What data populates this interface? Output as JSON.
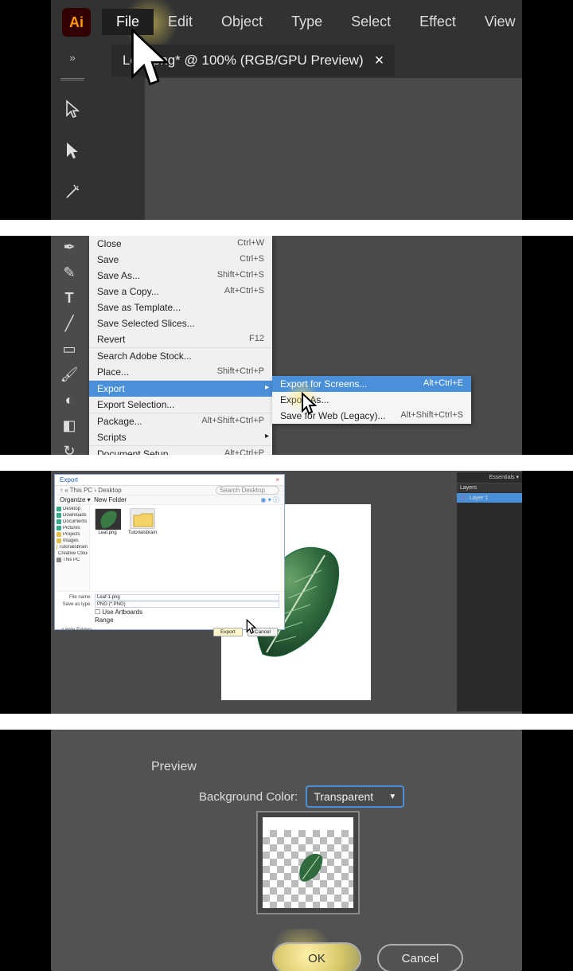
{
  "panel1": {
    "logo": "Ai",
    "menus": [
      "File",
      "Edit",
      "Object",
      "Type",
      "Select",
      "Effect",
      "View"
    ],
    "tab_title": "Leaf.png* @ 100% (RGB/GPU Preview)",
    "tab_close": "×",
    "expand_tools": "»"
  },
  "panel2": {
    "file_menu": [
      {
        "label": "Close",
        "shortcut": "Ctrl+W"
      },
      {
        "label": "Save",
        "shortcut": "Ctrl+S"
      },
      {
        "label": "Save As...",
        "shortcut": "Shift+Ctrl+S"
      },
      {
        "label": "Save a Copy...",
        "shortcut": "Alt+Ctrl+S"
      },
      {
        "label": "Save as Template...",
        "shortcut": ""
      },
      {
        "label": "Save Selected Slices...",
        "shortcut": ""
      },
      {
        "label": "Revert",
        "shortcut": "F12",
        "sep": true
      },
      {
        "label": "Search Adobe Stock...",
        "shortcut": ""
      },
      {
        "label": "Place...",
        "shortcut": "Shift+Ctrl+P",
        "sep": true
      },
      {
        "label": "Export",
        "shortcut": "",
        "hi": true,
        "sub": true
      },
      {
        "label": "Export Selection...",
        "shortcut": "",
        "sep": true
      },
      {
        "label": "Package...",
        "shortcut": "Alt+Shift+Ctrl+P"
      },
      {
        "label": "Scripts",
        "shortcut": "",
        "sub": true,
        "sep": true
      },
      {
        "label": "Document Setup...",
        "shortcut": "Alt+Ctrl+P"
      }
    ],
    "sub_menu": [
      {
        "label": "Export for Screens...",
        "shortcut": "Alt+Ctrl+E",
        "hi": true
      },
      {
        "label": "Export As...",
        "shortcut": ""
      },
      {
        "label": "Save for Web (Legacy)...",
        "shortcut": "Alt+Shift+Ctrl+S"
      }
    ]
  },
  "panel3": {
    "dialog_title": "Export",
    "breadcrumb": "↑  «  This PC  ›  Desktop",
    "search_placeholder": "Search Desktop",
    "organize": "Organize ▾",
    "newfolder": "New Folder",
    "tree": [
      "Desktop",
      "Downloads",
      "Documents",
      "Pictures",
      "Projects",
      "Images",
      "Tutorialsbrain",
      "Creative Cloud Fi",
      "This PC"
    ],
    "thumbs": [
      {
        "label": "Leaf.png"
      },
      {
        "label": "Tutorialsbrain"
      }
    ],
    "filename_label": "File name:",
    "filename_value": "Leaf-1.png",
    "saveas_label": "Save as type:",
    "saveas_value": "PNG (*.PNG)",
    "use_artboards": "Use Artboards",
    "range": "Range",
    "export_btn": "Export",
    "cancel_btn": "Cancel",
    "hide_folders": "˅ Hide Folders",
    "right_top": "Essentials ▾",
    "layer_tab": "Layers",
    "layer1": "Layer 1"
  },
  "panel4": {
    "preview_title": "Preview",
    "bgc_label": "Background Color:",
    "bgc_value": "Transparent",
    "ok": "OK",
    "cancel": "Cancel"
  }
}
